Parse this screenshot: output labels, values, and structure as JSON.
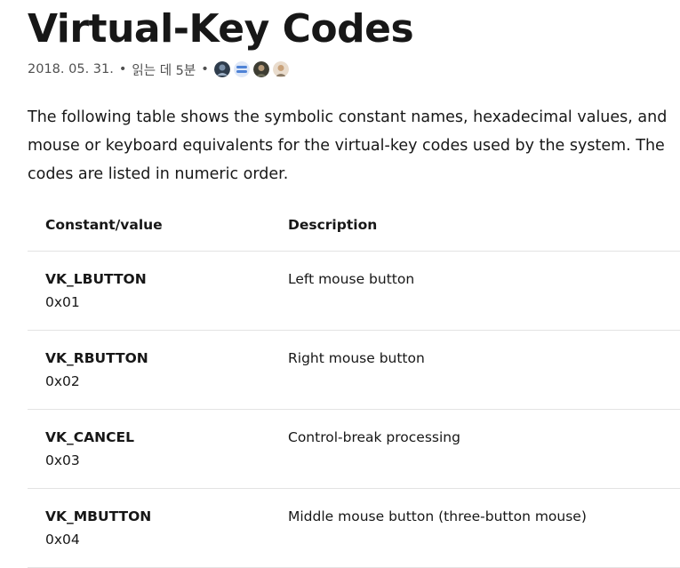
{
  "article": {
    "title": "Virtual-Key Codes",
    "date": "2018. 05. 31.",
    "read_time": "읽는 데 5분",
    "bullet": "•",
    "intro": "The following table shows the symbolic constant names, hexadecimal values, and mouse or keyboard equivalents for the virtual-key codes used by the system. The codes are listed in numeric order."
  },
  "contributors": [
    {
      "icon": "contributor-avatar-1",
      "color": "#3a4a5a"
    },
    {
      "icon": "contributor-avatar-2",
      "color": "#5b8bd8"
    },
    {
      "icon": "contributor-avatar-3",
      "color": "#4a4a3a"
    },
    {
      "icon": "contributor-avatar-4",
      "color": "#c9a27a"
    }
  ],
  "table": {
    "headers": [
      "Constant/value",
      "Description"
    ],
    "rows": [
      {
        "name": "VK_LBUTTON",
        "value": "0x01",
        "description": "Left mouse button"
      },
      {
        "name": "VK_RBUTTON",
        "value": "0x02",
        "description": "Right mouse button"
      },
      {
        "name": "VK_CANCEL",
        "value": "0x03",
        "description": "Control-break processing"
      },
      {
        "name": "VK_MBUTTON",
        "value": "0x04",
        "description": "Middle mouse button (three-button mouse)"
      }
    ]
  }
}
